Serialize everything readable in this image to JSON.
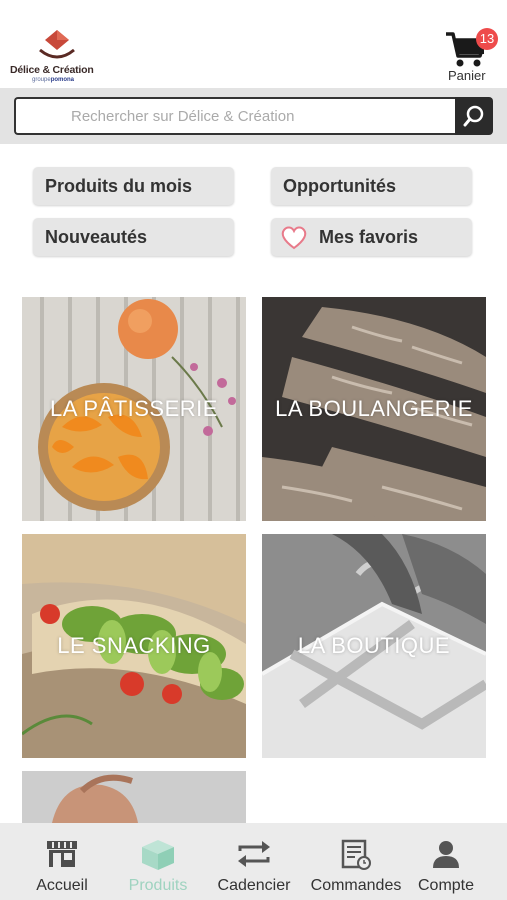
{
  "header": {
    "logo_name": "Délice & Création",
    "logo_group_prefix": "groupe",
    "logo_group_brand": "pomona",
    "cart_label": "Panier",
    "cart_count": "13"
  },
  "search": {
    "placeholder": "Rechercher sur Délice & Création",
    "button_icon": "search-icon"
  },
  "quick_links": [
    {
      "label": "Produits du mois"
    },
    {
      "label": "Opportunités"
    },
    {
      "label": "Nouveautés"
    },
    {
      "label": "Mes favoris",
      "icon": "heart-icon"
    }
  ],
  "categories": [
    {
      "label": "LA PÂTISSERIE"
    },
    {
      "label": "LA BOULANGERIE"
    },
    {
      "label": "LE SNACKING"
    },
    {
      "label": "LA BOUTIQUE"
    }
  ],
  "bottom_nav": [
    {
      "label": "Accueil",
      "icon": "store-icon",
      "active": false
    },
    {
      "label": "Produits",
      "icon": "box-icon",
      "active": true
    },
    {
      "label": "Cadencier",
      "icon": "repeat-icon",
      "active": false
    },
    {
      "label": "Commandes",
      "icon": "orders-icon",
      "active": false
    },
    {
      "label": "Compte",
      "icon": "user-icon",
      "active": false
    }
  ],
  "colors": {
    "badge": "#ee4b4b",
    "active_nav": "#9fd3c0",
    "logo_red": "#c8493a"
  }
}
